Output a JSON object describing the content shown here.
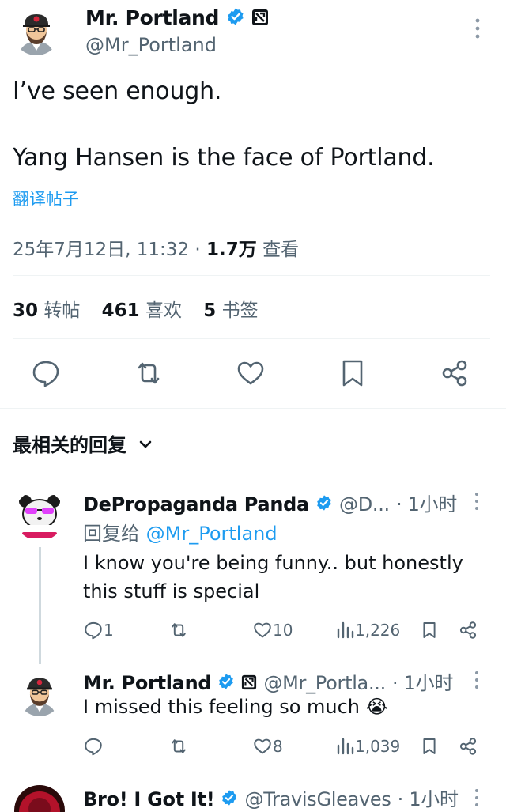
{
  "post": {
    "author_name": "Mr. Portland",
    "author_handle": "@Mr_Portland",
    "text_line_1": "I’ve seen enough.",
    "text_line_2": "Yang Hansen is the face of Portland.",
    "translate_label": "翻译帖子",
    "timestamp": "25年7月12日, 11:32",
    "separator": "·",
    "views_count": "1.7万",
    "views_label": "查看",
    "reposts_count": "30",
    "reposts_label": "转帖",
    "likes_count": "461",
    "likes_label": "喜欢",
    "bookmarks_count": "5",
    "bookmarks_label": "书签"
  },
  "actions": {
    "icons": [
      "reply-icon",
      "repost-icon",
      "like-icon",
      "bookmark-icon",
      "share-icon"
    ]
  },
  "replies_sort": {
    "label": "最相关的回复"
  },
  "replies": [
    {
      "name": "DePropaganda Panda",
      "handle": "@D...",
      "time": "· 1小时",
      "reply_to_prefix": "回复给",
      "reply_to_handle": "@Mr_Portland",
      "text_line_1": "I know you're being funny.. but honestly",
      "text_line_2": "this stuff is special",
      "reply_count": "1",
      "repost_count": "",
      "like_count": "10",
      "view_count": "1,226"
    },
    {
      "name": "Mr. Portland",
      "handle": "@Mr_Portla...",
      "time": "· 1小时",
      "text_line_1": "I missed this feeling so much 😭",
      "reply_count": "",
      "repost_count": "",
      "like_count": "8",
      "view_count": "1,039"
    },
    {
      "name": "Bro! I Got It!",
      "handle": "@TravisGleaves",
      "time": "· 1小时"
    }
  ],
  "colors": {
    "accent": "#1d9bf0",
    "muted": "#536471",
    "text": "#0f1419",
    "divider": "#eff3f4"
  }
}
